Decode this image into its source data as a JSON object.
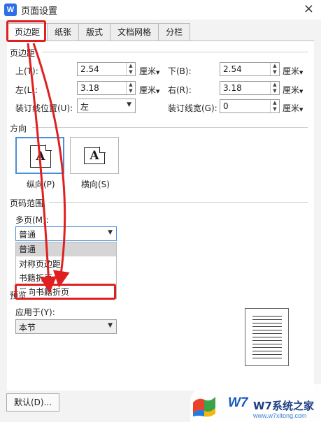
{
  "window": {
    "title": "页面设置",
    "logo_letter": "W",
    "close_glyph": "×"
  },
  "tabs": [
    {
      "label": "页边距",
      "active": true
    },
    {
      "label": "纸张",
      "active": false
    },
    {
      "label": "版式",
      "active": false
    },
    {
      "label": "文档网格",
      "active": false
    },
    {
      "label": "分栏",
      "active": false
    }
  ],
  "margins": {
    "section_title": "页边距",
    "top_label": "上(T):",
    "top_value": "2.54",
    "bottom_label": "下(B):",
    "bottom_value": "2.54",
    "left_label": "左(L):",
    "left_value": "3.18",
    "right_label": "右(R):",
    "right_value": "3.18",
    "unit": "厘米",
    "gutter_pos_label": "装订线位置(U):",
    "gutter_pos_value": "左",
    "gutter_width_label": "装订线宽(G):",
    "gutter_width_value": "0"
  },
  "orientation": {
    "section_title": "方向",
    "portrait_label": "纵向(P)",
    "landscape_label": "横向(S)",
    "glyph": "A",
    "selected": "portrait"
  },
  "pages": {
    "section_title": "页码范围",
    "multiple_label": "多页(M):",
    "multiple_value": "普通",
    "options": [
      "普通",
      "对称页边距",
      "书籍折页",
      "反向书籍折页"
    ],
    "highlighted": "普通",
    "boxed_option": "反向书籍折页"
  },
  "preview": {
    "section_title": "预览",
    "apply_label": "应用于(Y):",
    "apply_value": "本节"
  },
  "footer": {
    "default_button": "默认(D)..."
  },
  "watermark": {
    "brand": "W7系统之家",
    "url": "www.w7xitong.com",
    "logo_text": "W7"
  },
  "colors": {
    "accent": "#2f6fe6",
    "annotation_red": "#e02020",
    "selection_blue": "#4a8fd8"
  }
}
